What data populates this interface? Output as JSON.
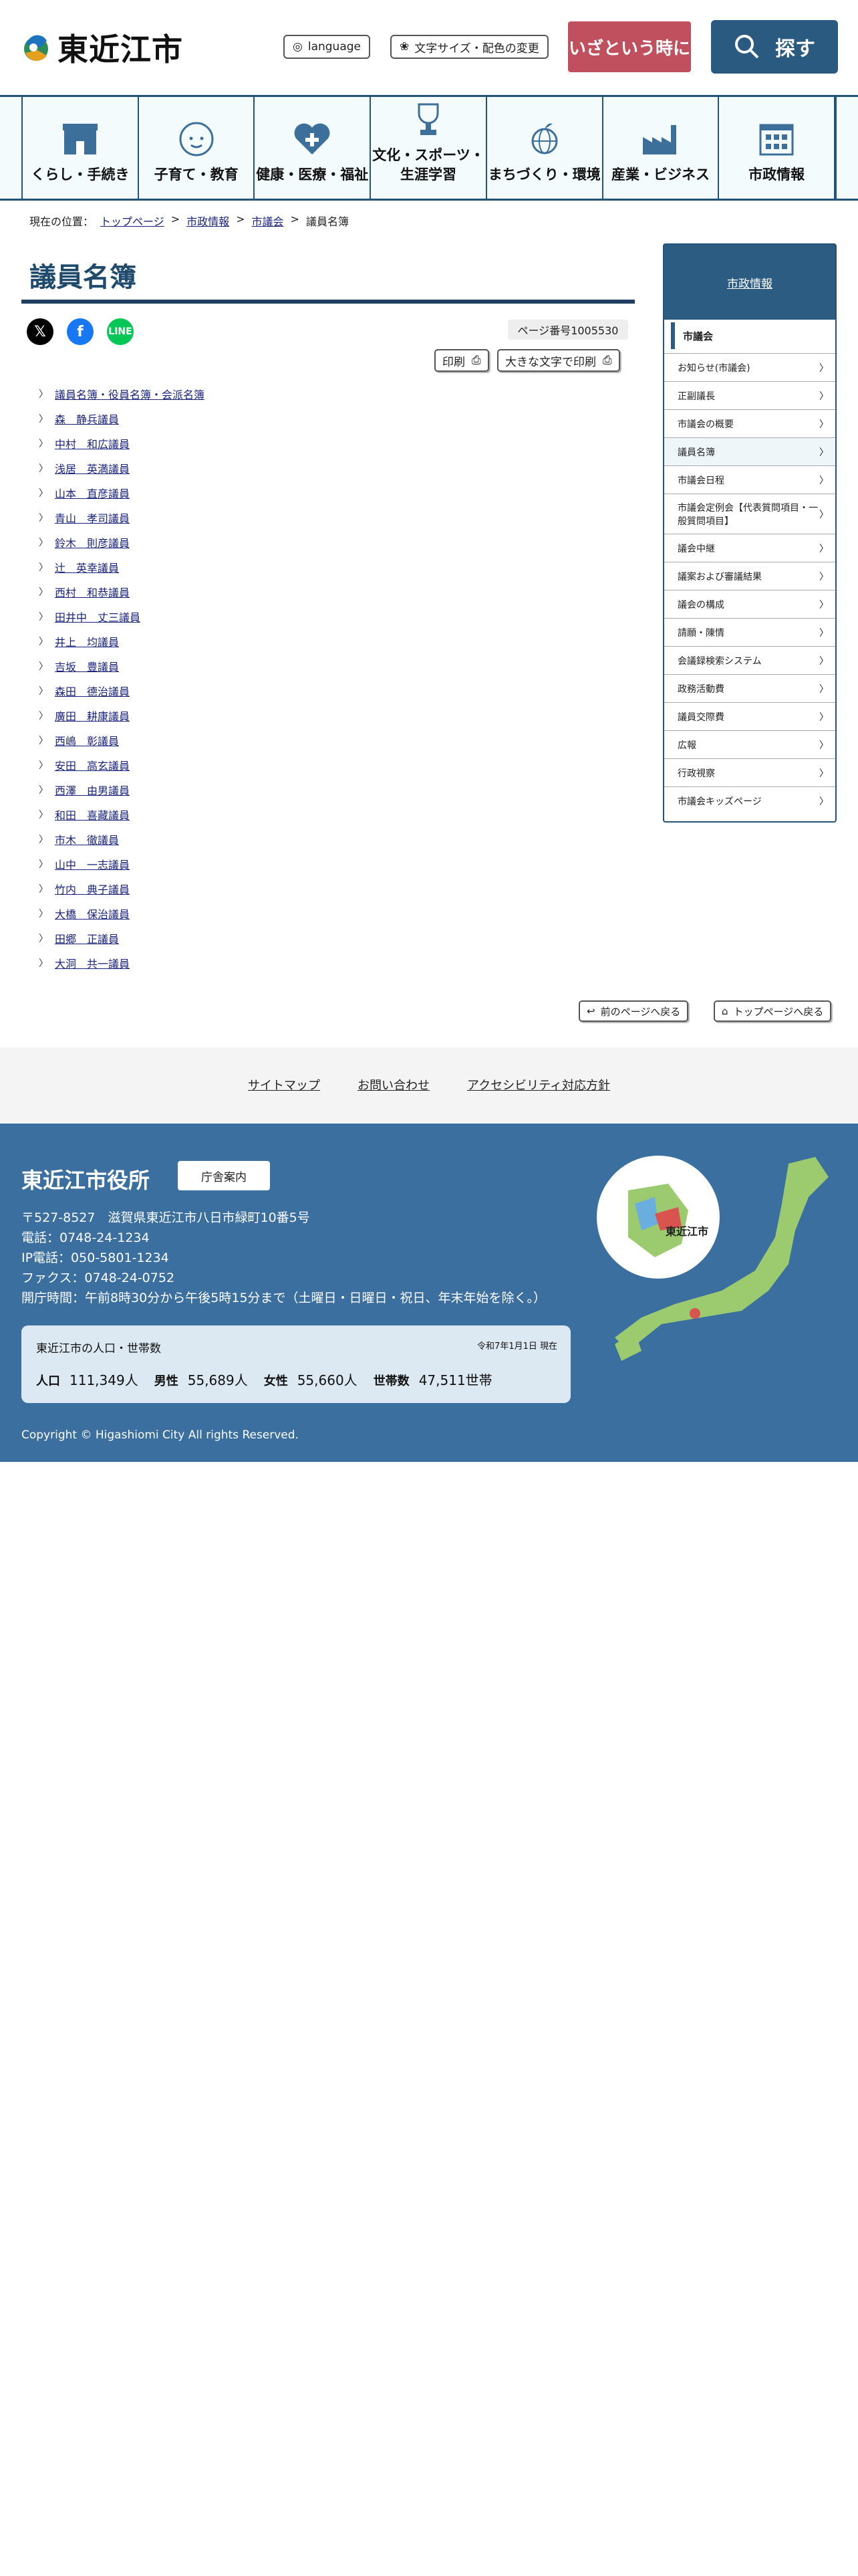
{
  "header": {
    "site_name": "東近江市",
    "language": "language",
    "font_color": "文字サイズ・配色の変更",
    "emergency": "いざという時に",
    "search": "探す"
  },
  "nav": [
    {
      "label": "くらし・手続き",
      "icon": "house-icon"
    },
    {
      "label": "子育て・教育",
      "icon": "baby-icon"
    },
    {
      "label": "健康・医療・福祉",
      "icon": "heart-icon"
    },
    {
      "label": "文化・スポーツ・\n生涯学習",
      "icon": "trophy-icon"
    },
    {
      "label": "まちづくり・環境",
      "icon": "globe-icon"
    },
    {
      "label": "産業・ビジネス",
      "icon": "factory-icon"
    },
    {
      "label": "市政情報",
      "icon": "building-icon"
    }
  ],
  "breadcrumb": {
    "label": "現在の位置：",
    "items": [
      "トップページ",
      "市政情報",
      "市議会"
    ],
    "current": "議員名簿",
    "sep": ">"
  },
  "page": {
    "title": "議員名簿",
    "page_no": "ページ番号1005530",
    "print": "印刷",
    "print_large": "大きな文字で印刷"
  },
  "members": [
    "議員名簿・役員名簿・会派名簿",
    "森　静兵議員",
    "中村　和広議員",
    "浅居　英満議員",
    "山本　直彦議員",
    "青山　孝司議員",
    "鈴木　則彦議員",
    "辻　英幸議員",
    "西村　和恭議員",
    "田井中　丈三議員",
    "井上　均議員",
    "吉坂　豊議員",
    "森田　德治議員",
    "廣田　耕康議員",
    "西嶋　彰議員",
    "安田　高玄議員",
    "西澤　由男議員",
    "和田　喜藏議員",
    "市木　徹議員",
    "山中　一志議員",
    "竹内　典子議員",
    "大橋　保治議員",
    "田郷　正議員",
    "大洞　共一議員"
  ],
  "sidebar": {
    "heading": "市政情報",
    "section": "市議会",
    "items": [
      "お知らせ(市議会)",
      "正副議長",
      "市議会の概要",
      "議員名簿",
      "市議会日程",
      "市議会定例会【代表質問項目・一般質問項目】",
      "議会中継",
      "議案および審議結果",
      "議会の構成",
      "請願・陳情",
      "会議録検索システム",
      "政務活動費",
      "議員交際費",
      "広報",
      "行政視察",
      "市議会キッズページ"
    ],
    "active": 3
  },
  "back": {
    "prev": "前のページへ戻る",
    "top": "トップページへ戻る"
  },
  "footer_links": [
    "サイトマップ",
    "お問い合わせ",
    "アクセシビリティ対応方針"
  ],
  "footer": {
    "name": "東近江市役所",
    "gov_guide": "庁舎案内",
    "address": "〒527-8527　滋賀県東近江市八日市緑町10番5号",
    "tel": "電話：0748-24-1234",
    "ip": "IP電話：050-5801-1234",
    "fax": "ファクス：0748-24-0752",
    "hours": "開庁時間：午前8時30分から午後5時15分まで（土曜日・日曜日・祝日、年末年始を除く。）",
    "map_label": "東近江市",
    "pop_title": "東近江市の人口・世帯数",
    "pop_date": "令和7年1月1日 現在",
    "pop_label": "人口",
    "pop": "111,349人",
    "male_label": "男性",
    "male": "55,689人",
    "female_label": "女性",
    "female": "55,660人",
    "house_label": "世帯数",
    "house": "47,511世帯",
    "copyright": "Copyright © Higashiomi City All rights Reserved."
  }
}
